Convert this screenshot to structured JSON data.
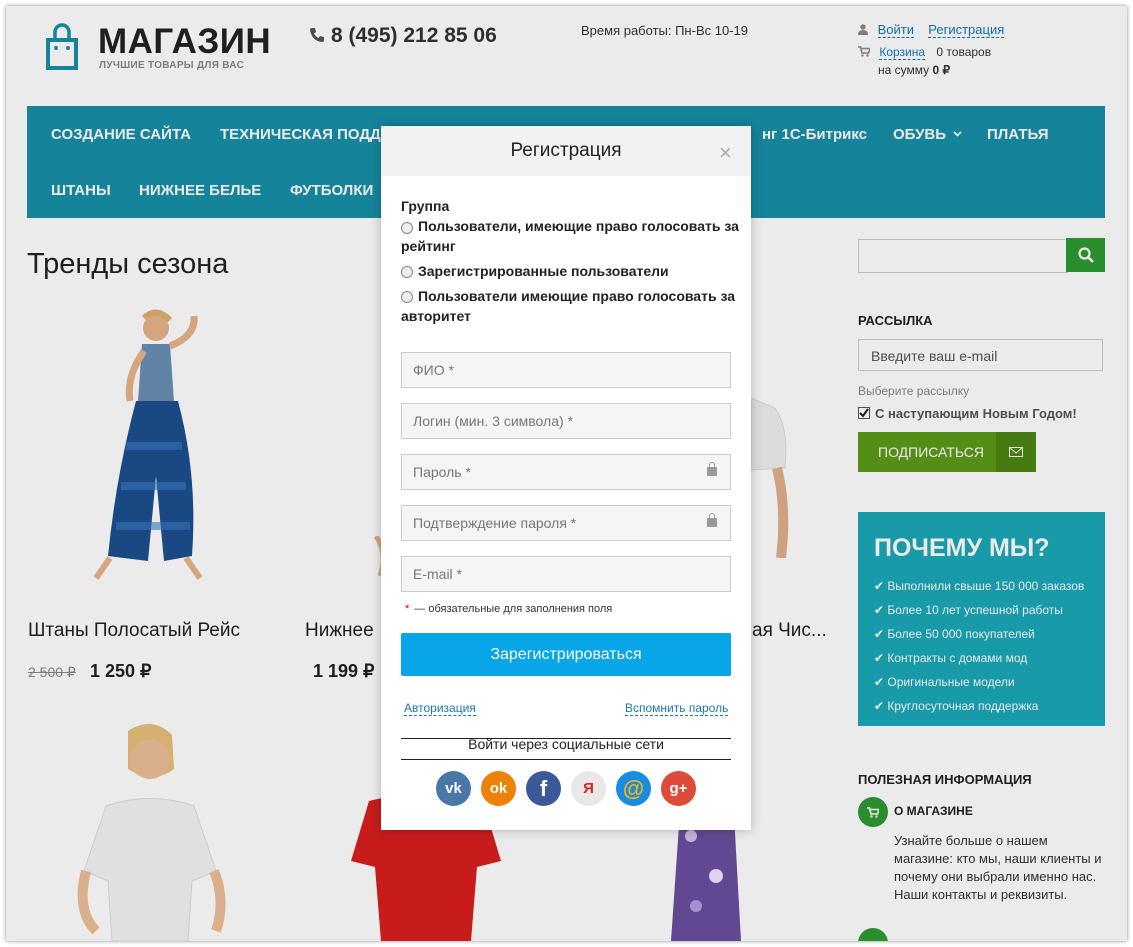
{
  "header": {
    "logo_title": "МАГАЗИН",
    "logo_subtitle": "ЛУЧШИЕ ТОВАРЫ ДЛЯ ВАС",
    "phone": "8 (495) 212 85 06",
    "hours": "Время работы: Пн-Вс 10-19",
    "login": "Войти",
    "register": "Регистрация",
    "cart_label": "Корзина",
    "cart_count": "0 товаров",
    "cart_sum_label": "на сумму",
    "cart_sum": "0 ₽"
  },
  "nav": {
    "items": [
      "Создание сайта",
      "Техническая подд",
      "нг 1С-Битрикс",
      "Обувь",
      "Платья",
      "Штаны",
      "Нижнее белье",
      "Футболки"
    ]
  },
  "main": {
    "title": "Тренды сезона",
    "products": [
      {
        "name": "Штаны Полосатый Рейс",
        "old_price": "2 500 ₽",
        "price": "1 250 ₽"
      },
      {
        "name": "Нижнее",
        "old_price": "",
        "price": "1 199 ₽"
      },
      {
        "name": "ая Чис...",
        "old_price": "",
        "price": ""
      }
    ]
  },
  "sidebar": {
    "newsletter_title": "РАССЫЛКА",
    "email_placeholder": "Введите ваш e-mail",
    "choose_label": "Выберите рассылку",
    "newsletter_option": "С наступающим Новым Годом!",
    "subscribe": "ПОДПИСАТЬСЯ",
    "why_title": "ПОЧЕМУ МЫ?",
    "why_items": [
      "Выполнили свыше 150 000 заказов",
      "Более 10 лет успешной работы",
      "Более 50 000 покупателей",
      "Контракты с домами мод",
      "Оригинальные модели",
      "Круглосуточная поддержка"
    ],
    "useful_title": "ПОЛЕЗНАЯ ИНФОРМАЦИЯ",
    "about_title": "О МАГАЗИНЕ",
    "about_text": "Узнайте больше о нашем магазине: кто мы, наши клиенты и почему они выбрали именно нас. Наши контакты и реквизиты."
  },
  "modal": {
    "title": "Регистрация",
    "close": "×",
    "group_label": "Группа",
    "options": [
      "Пользователи, имеющие право голосовать за рейтинг",
      "Зарегистрированные пользователи",
      "Пользователи имеющие право голосовать за авторитет"
    ],
    "fields": {
      "fio": "ФИО *",
      "login": "Логин (мин. 3 символа) *",
      "password": "Пароль *",
      "confirm": "Подтверждение пароля *",
      "email": "E-mail *"
    },
    "required_note": "— обязательные для заполнения поля",
    "required_star": "*",
    "submit": "Зарегистрироваться",
    "auth_link": "Авторизация",
    "forgot_link": "Вспомнить пароль",
    "social_label": "Войти через социальные сети",
    "socials": [
      {
        "name": "vk",
        "glyph": "vk",
        "color": "#4a76a8"
      },
      {
        "name": "ok",
        "glyph": "ok",
        "color": "#ee8208"
      },
      {
        "name": "facebook",
        "glyph": "f",
        "color": "#3b5998"
      },
      {
        "name": "yandex",
        "glyph": "Я",
        "color": "#e8e8e8"
      },
      {
        "name": "mail",
        "glyph": "@",
        "color": "#168de2"
      },
      {
        "name": "google-plus",
        "glyph": "g+",
        "color": "#dd4b39"
      }
    ]
  }
}
